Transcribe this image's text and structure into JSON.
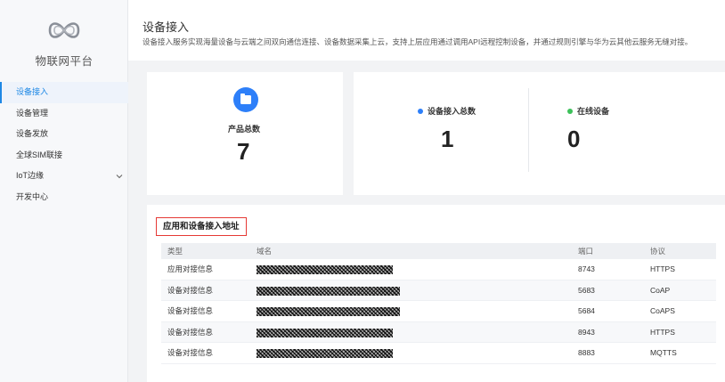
{
  "sidebar": {
    "brand": "物联网平台",
    "items": [
      {
        "label": "设备接入"
      },
      {
        "label": "设备管理"
      },
      {
        "label": "设备发放"
      },
      {
        "label": "全球SIM联接"
      },
      {
        "label": "IoT边缘"
      },
      {
        "label": "开发中心"
      }
    ]
  },
  "header": {
    "title": "设备接入",
    "description": "设备接入服务实现海量设备与云端之间双向通信连接、设备数据采集上云，支持上层应用通过调用API远程控制设备，并通过规则引擎与华为云其他云服务无缝对接。"
  },
  "stats": {
    "products": {
      "label": "产品总数",
      "value": "7"
    },
    "devices_total": {
      "label": "设备接入总数",
      "value": "1"
    },
    "devices_online": {
      "label": "在线设备",
      "value": "0"
    }
  },
  "colors": {
    "accent": "#1e88e5",
    "dot_blue": "#2d7ff9",
    "dot_green": "#3cc15a",
    "highlight_border": "#e53935"
  },
  "address_panel": {
    "title": "应用和设备接入地址",
    "columns": {
      "type": "类型",
      "domain": "域名",
      "port": "端口",
      "protocol": "协议"
    },
    "rows": [
      {
        "type": "应用对接信息",
        "port": "8743",
        "protocol": "HTTPS"
      },
      {
        "type": "设备对接信息",
        "port": "5683",
        "protocol": "CoAP"
      },
      {
        "type": "设备对接信息",
        "port": "5684",
        "protocol": "CoAPS"
      },
      {
        "type": "设备对接信息",
        "port": "8943",
        "protocol": "HTTPS"
      },
      {
        "type": "设备对接信息",
        "port": "8883",
        "protocol": "MQTTS"
      }
    ]
  }
}
